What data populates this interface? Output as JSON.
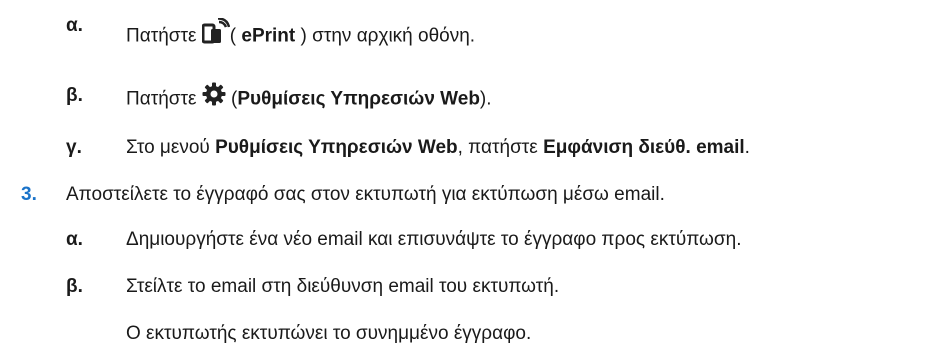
{
  "steps": {
    "alpha1": {
      "marker": "α.",
      "t1": "Πατήστε",
      "t2": "( ",
      "b1": "ePrint",
      "t3": " ) στην αρχική οθόνη.",
      "icon": "eprint-icon"
    },
    "beta1": {
      "marker": "β.",
      "t1": "Πατήστε",
      "t2": " (",
      "b1": "Ρυθμίσεις Υπηρεσιών Web",
      "t3": ").",
      "icon": "gear-icon"
    },
    "gamma1": {
      "marker": "γ.",
      "t1": "Στο μενού ",
      "b1": "Ρυθμίσεις Υπηρεσιών Web",
      "t2": ", πατήστε ",
      "b2": "Εμφάνιση διεύθ. email",
      "t3": "."
    },
    "step3": {
      "marker": "3.",
      "text": "Αποστείλετε το έγγραφό σας στον εκτυπωτή για εκτύπωση μέσω email."
    },
    "alpha2": {
      "marker": "α.",
      "text": "Δημιουργήστε ένα νέο email και επισυνάψτε το έγγραφο προς εκτύπωση."
    },
    "beta2": {
      "marker": "β.",
      "text": "Στείλτε το email στη διεύθυνση email του εκτυπωτή."
    },
    "result": {
      "text": "Ο εκτυπωτής εκτυπώνει το συνημμένο έγγραφο."
    }
  },
  "colors": {
    "step_number": "#1a73c9",
    "text": "#1a1a1a"
  }
}
